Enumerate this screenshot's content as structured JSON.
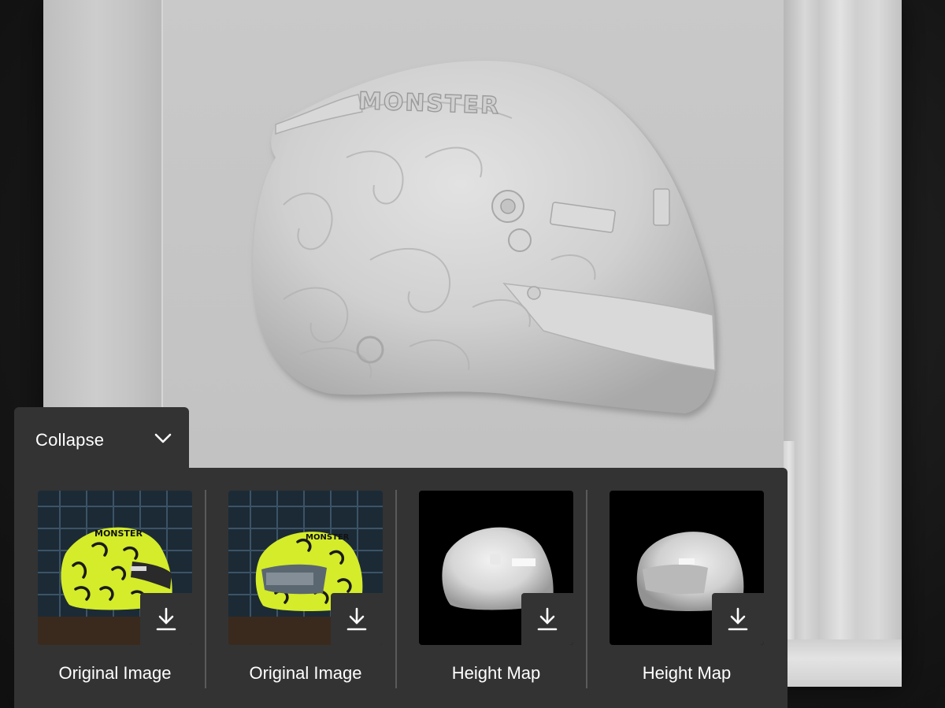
{
  "panel": {
    "toggle_label": "Collapse",
    "chevron_icon": "chevron-down-icon"
  },
  "viewport": {
    "relief_text": "MONSTER"
  },
  "cards": [
    {
      "label": "Original Image",
      "kind": "color",
      "download_icon": "download-icon"
    },
    {
      "label": "Original Image",
      "kind": "color",
      "download_icon": "download-icon"
    },
    {
      "label": "Height Map",
      "kind": "heightmap",
      "download_icon": "download-icon"
    },
    {
      "label": "Height Map",
      "kind": "heightmap",
      "download_icon": "download-icon"
    }
  ],
  "colors": {
    "panel_bg": "#333333",
    "helmet_neon": "#d4ec2a",
    "tile_blue": "#1f2f3d",
    "text": "#ffffff"
  }
}
